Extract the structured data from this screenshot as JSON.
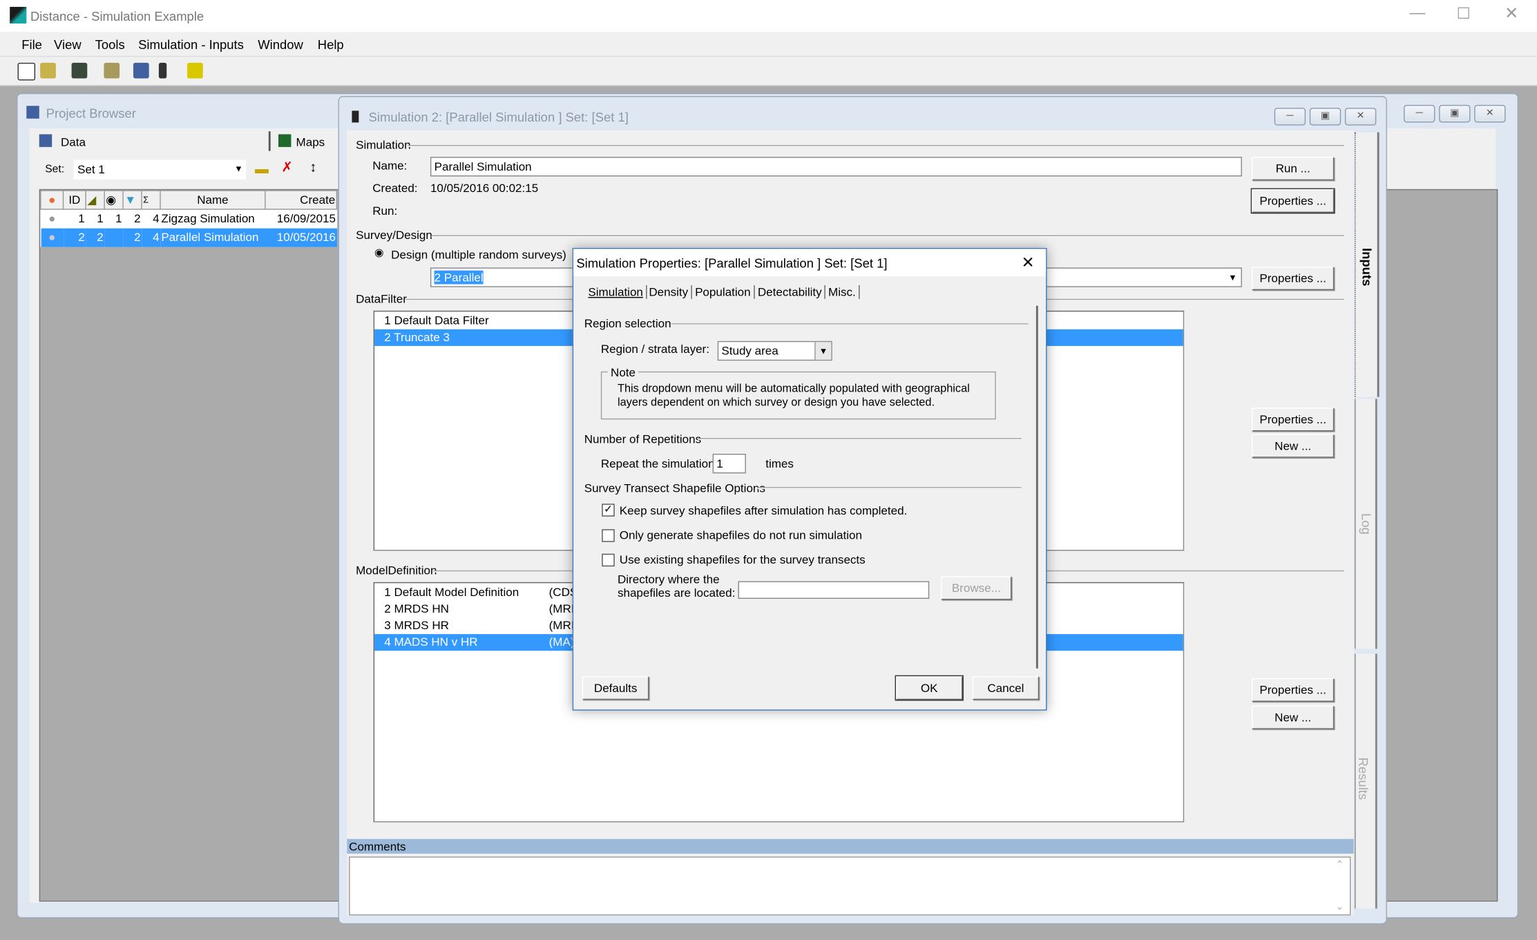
{
  "app": {
    "title": "Distance - Simulation Example"
  },
  "menu": [
    "File",
    "View",
    "Tools",
    "Simulation - Inputs",
    "Window",
    "Help"
  ],
  "toolbar_icons": [
    "new-project-icon",
    "open-project-icon",
    "save-icon",
    "import-icon",
    "project-browser-icon",
    "log-icon",
    "help-icon"
  ],
  "project_browser": {
    "title": "Project Browser",
    "tabs": [
      "Data",
      "Maps"
    ],
    "set_label": "Set:",
    "set_value": "Set 1",
    "columns": [
      "ID",
      "Name",
      "Create"
    ],
    "rows": [
      {
        "id": "1",
        "c2": "1",
        "c3": "1",
        "c4": "2",
        "c5": "4",
        "name": "Zigzag Simulation",
        "created": "16/09/2015",
        "selected": false
      },
      {
        "id": "2",
        "c2": "2",
        "c3": "",
        "c4": "2",
        "c5": "4",
        "name": "Parallel Simulation",
        "created": "10/05/2016",
        "selected": true
      }
    ]
  },
  "simulation_window": {
    "title": "Simulation 2: [Parallel Simulation ] Set: [Set 1]",
    "simulation_group": "Simulation",
    "name_label": "Name:",
    "name_value": "Parallel Simulation",
    "created_label": "Created:",
    "created_value": "10/05/2016 00:02:15",
    "run_label": "Run:",
    "run_button": "Run ...",
    "properties_button": "Properties ...",
    "new_button": "New ...",
    "survey_group": "Survey/Design",
    "design_radio": "Design (multiple random surveys)",
    "design_value": "2 Parallel",
    "datafilter_group": "DataFilter",
    "datafilters": [
      {
        "label": "1  Default Data Filter",
        "selected": false
      },
      {
        "label": "2  Truncate 3",
        "selected": true
      }
    ],
    "model_group": "ModelDefinition",
    "models": [
      {
        "label": "1  Default Model Definition",
        "engine": "(CDS",
        "selected": false
      },
      {
        "label": "2  MRDS HN",
        "engine": "(MRD",
        "selected": false
      },
      {
        "label": "3  MRDS HR",
        "engine": "(MRD",
        "selected": false
      },
      {
        "label": "4  MADS HN v HR",
        "engine": "(MA)",
        "selected": true
      }
    ],
    "comments_label": "Comments",
    "side_tabs": [
      "Inputs",
      "Log",
      "Results"
    ]
  },
  "dialog": {
    "title": "Simulation Properties: [Parallel Simulation ] Set: [Set 1]",
    "tabs": [
      "Simulation",
      "Density",
      "Population",
      "Detectability",
      "Misc."
    ],
    "region_group": "Region selection",
    "region_label": "Region / strata layer:",
    "region_value": "Study area",
    "note_label": "Note",
    "note_text": "This dropdown menu will be automatically populated with geographical layers dependent on which survey or design you have selected.",
    "reps_group": "Number of Repetitions",
    "repeat_label": "Repeat the simulation",
    "repeat_value": "1",
    "times_label": "times",
    "shapefile_group": "Survey Transect Shapefile Options",
    "options": [
      {
        "label": "Keep survey shapefiles after simulation has completed.",
        "checked": true
      },
      {
        "label": "Only generate shapefiles do not run simulation",
        "checked": false
      },
      {
        "label": "Use existing shapefiles for the survey transects",
        "checked": false
      }
    ],
    "dir_label_1": "Directory where the",
    "dir_label_2": "shapefiles are located:",
    "dir_value": "",
    "browse_button": "Browse...",
    "defaults_button": "Defaults",
    "ok_button": "OK",
    "cancel_button": "Cancel"
  }
}
